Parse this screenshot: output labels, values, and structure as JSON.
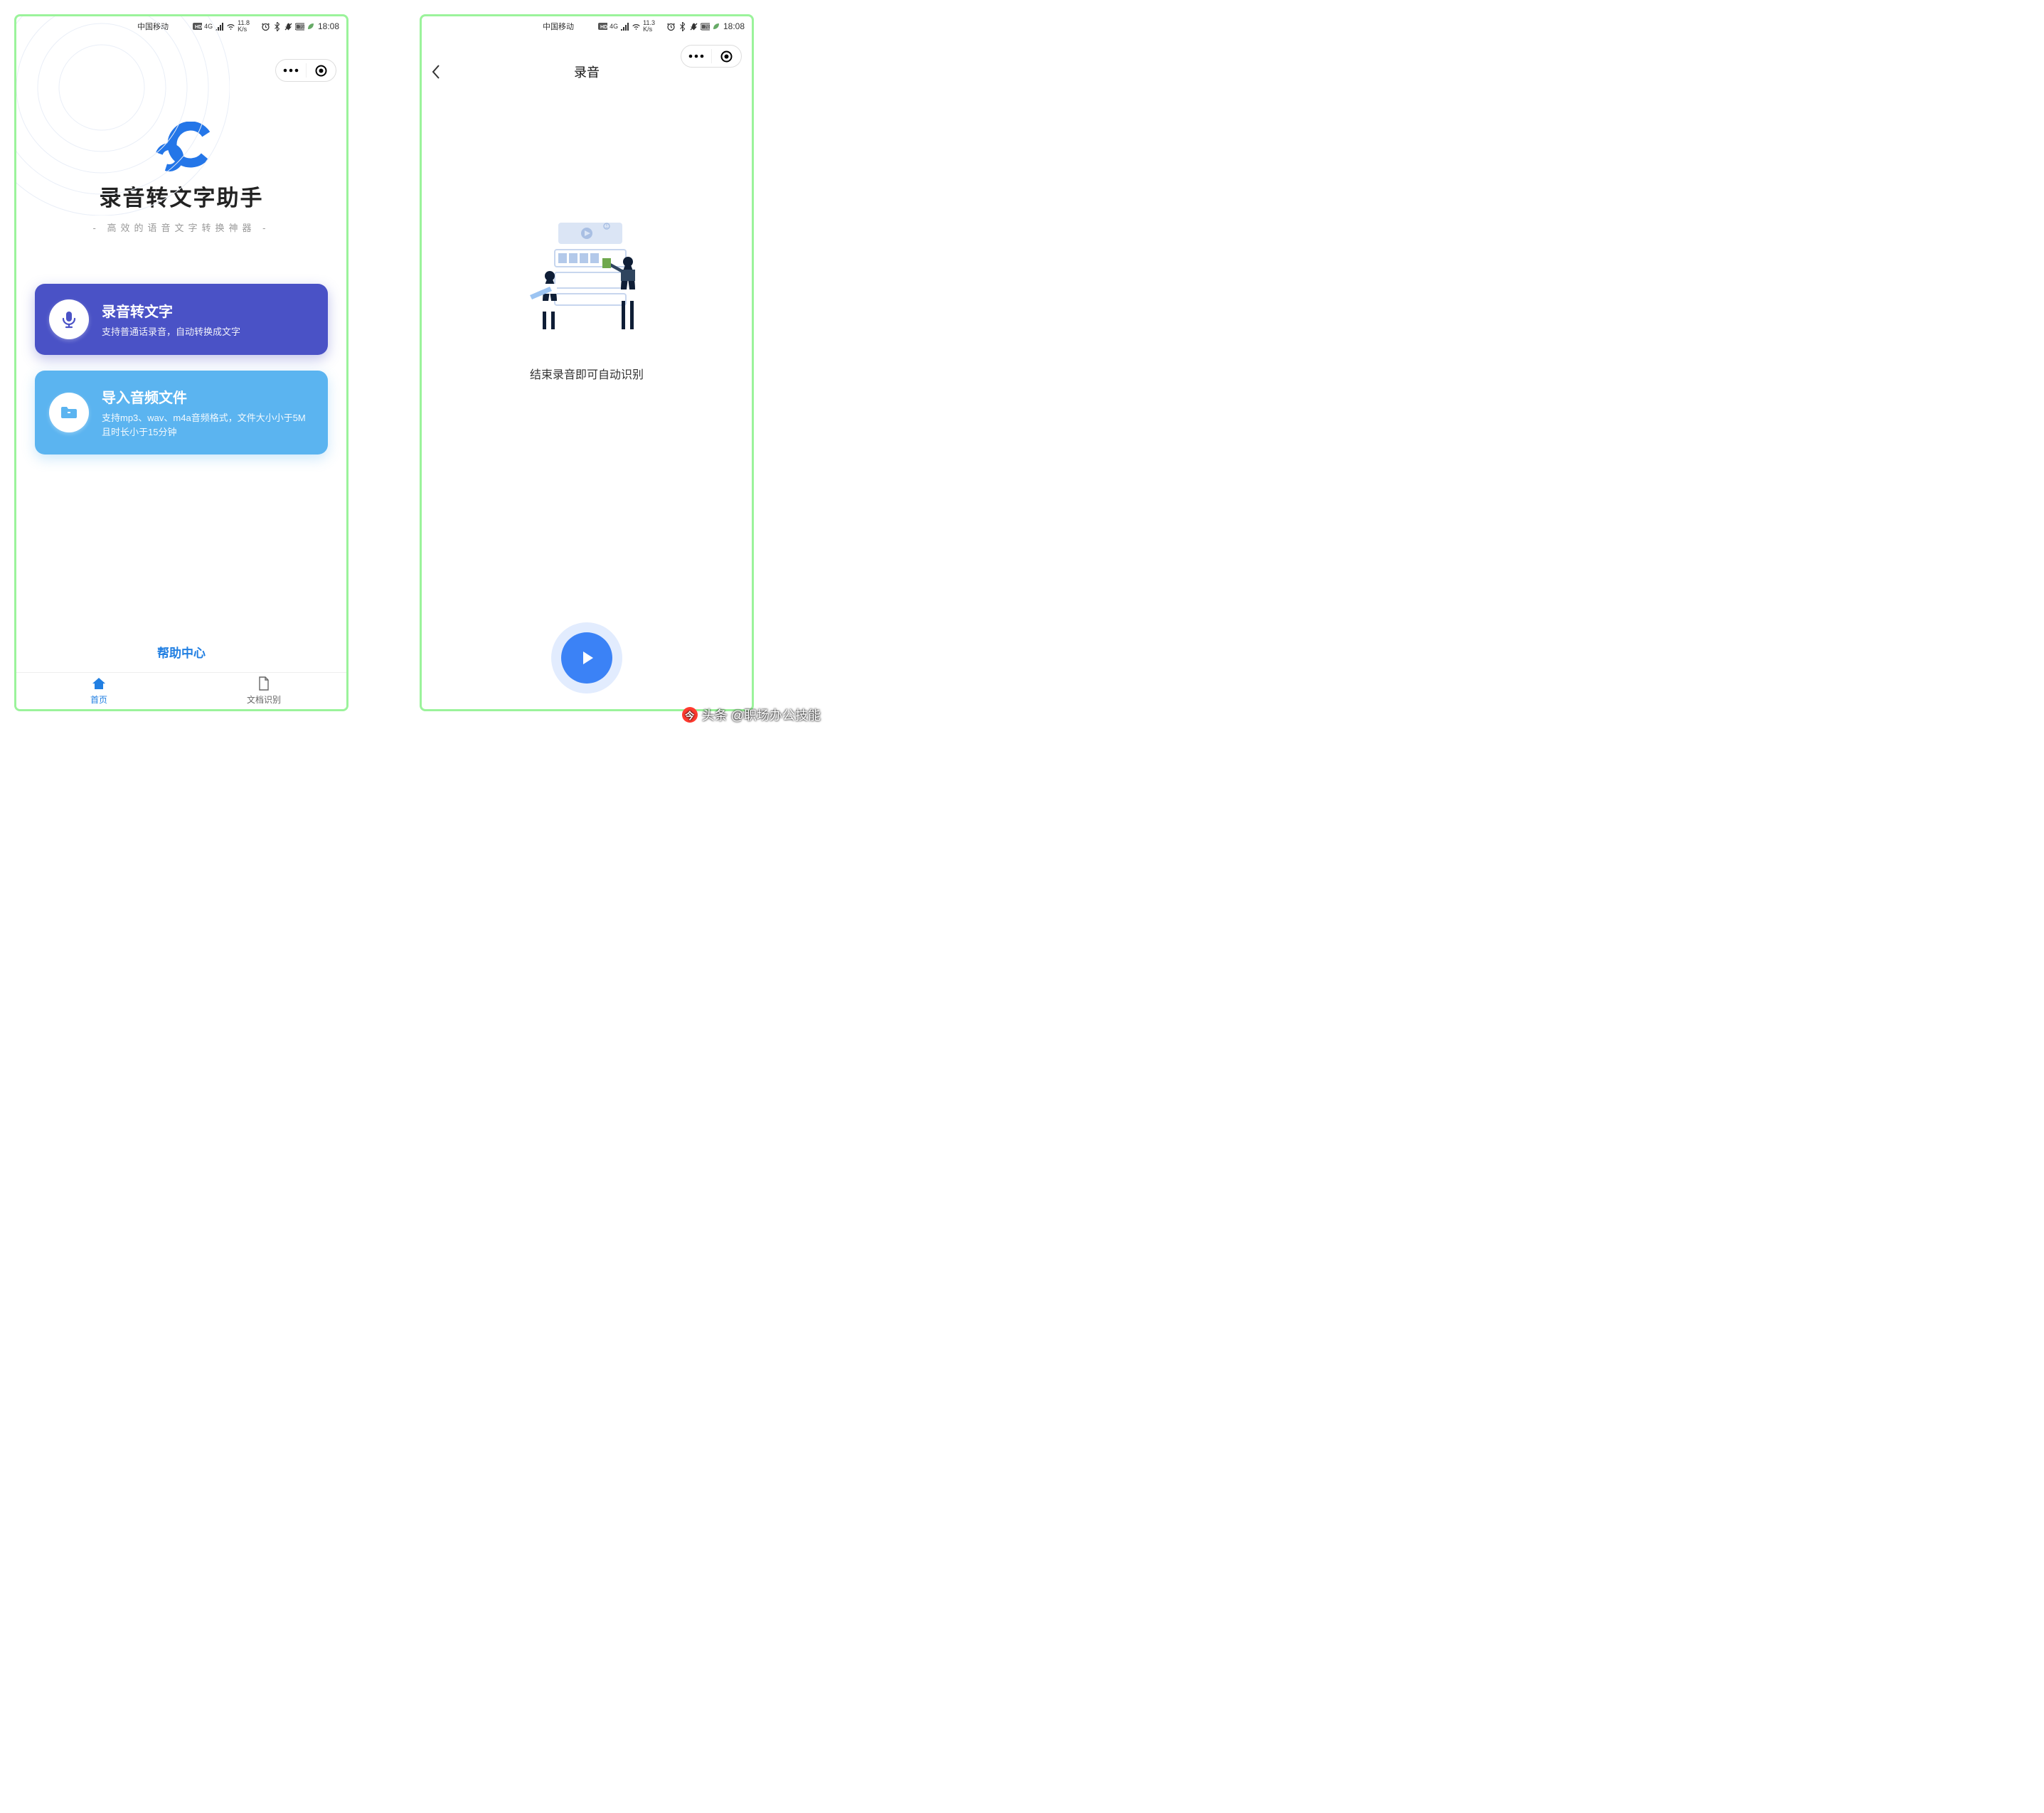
{
  "status": {
    "carrier": "中国移动",
    "hd": "HD",
    "net": "4G",
    "speed_unit": "K/s",
    "battery": "70"
  },
  "screen1": {
    "status_speed": "11.8",
    "status_time": "18:08",
    "app_title": "录音转文字助手",
    "app_subtitle": "- 高效的语音文字转换神器 -",
    "card1_title": "录音转文字",
    "card1_desc": "支持普通话录音，自动转换成文字",
    "card2_title": "导入音频文件",
    "card2_desc": "支持mp3、wav、m4a音频格式，文件大小小于5M且时长小于15分钟",
    "help_link": "帮助中心",
    "tab_home": "首页",
    "tab_doc": "文档识别"
  },
  "screen2": {
    "status_speed": "11.3",
    "status_time": "18:08",
    "page_title": "录音",
    "empty_hint": "结束录音即可自动识别"
  },
  "watermark": "头条 @职场办公技能"
}
